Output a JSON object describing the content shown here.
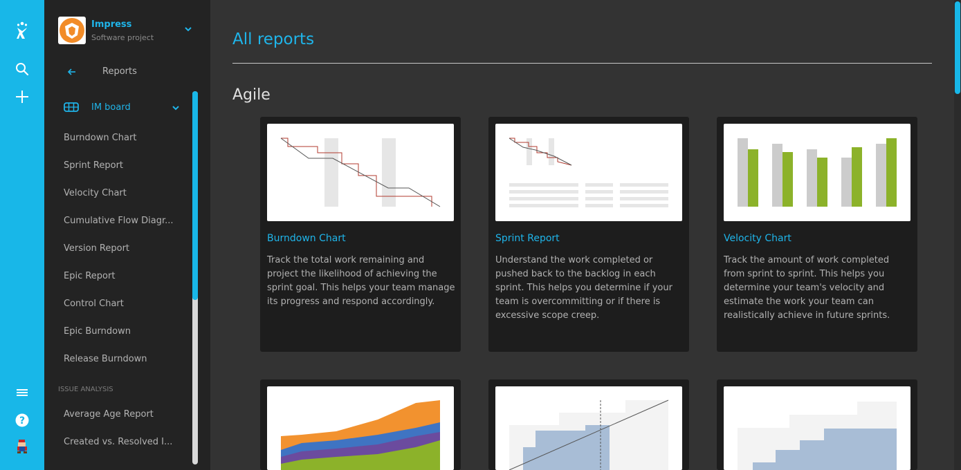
{
  "project": {
    "name": "Impress",
    "type": "Software project"
  },
  "nav": {
    "back_label": "Reports",
    "board_name": "IM board",
    "items": [
      "Burndown Chart",
      "Sprint Report",
      "Velocity Chart",
      "Cumulative Flow Diagr...",
      "Version Report",
      "Epic Report",
      "Control Chart",
      "Epic Burndown",
      "Release Burndown"
    ],
    "section_label": "ISSUE ANALYSIS",
    "analysis_items": [
      "Average Age Report",
      "Created vs. Resolved I..."
    ]
  },
  "main": {
    "title": "All reports",
    "section": "Agile",
    "cards": [
      {
        "title": "Burndown Chart",
        "description": "Track the total work remaining and project the likelihood of achieving the sprint goal. This helps your team manage its progress and respond accordingly."
      },
      {
        "title": "Sprint Report",
        "description": "Understand the work completed or pushed back to the backlog in each sprint. This helps you determine if your team is overcommitting or if there is excessive scope creep."
      },
      {
        "title": "Velocity Chart",
        "description": "Track the amount of work completed from sprint to sprint. This helps you determine your team's velocity and estimate the work your team can realistically achieve in future sprints."
      }
    ]
  },
  "colors": {
    "accent": "#18b7e8",
    "sidebar": "#232323",
    "main_bg": "#333333",
    "card_bg": "#1d1d1d"
  },
  "icons": [
    "jira-logo-icon",
    "search-icon",
    "plus-icon",
    "menu-icon",
    "help-icon",
    "user-avatar",
    "arrow-left-icon",
    "chevron-down-icon",
    "board-icon"
  ]
}
